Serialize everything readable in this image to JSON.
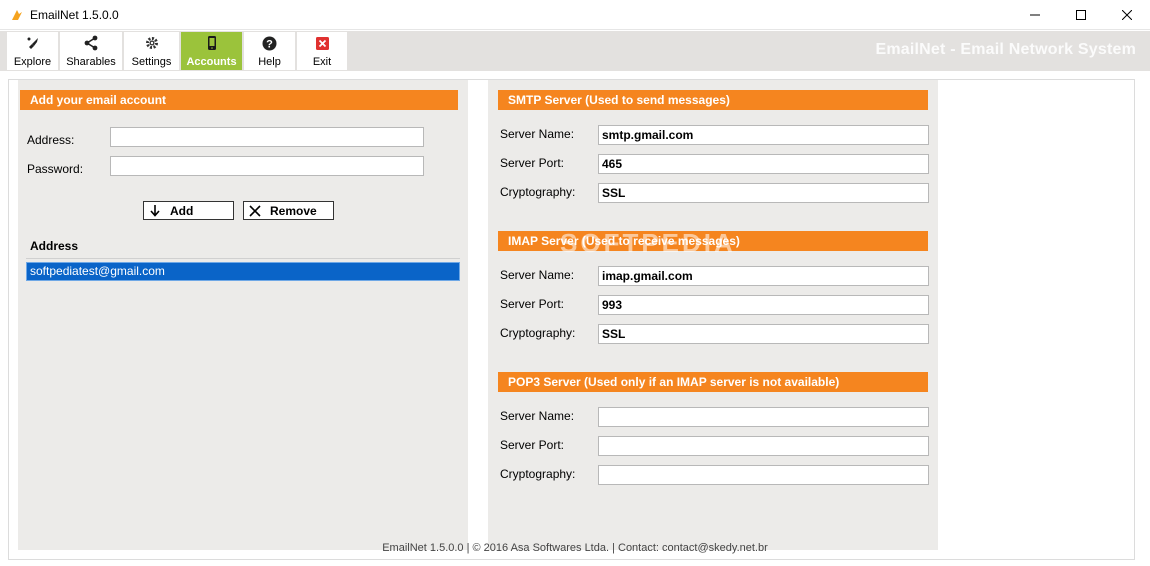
{
  "window": {
    "title": "EmailNet 1.5.0.0",
    "brand": "EmailNet - Email Network System"
  },
  "toolbar": {
    "items": [
      {
        "label": "Explore",
        "icon": "rocket-icon"
      },
      {
        "label": "Sharables",
        "icon": "share-icon"
      },
      {
        "label": "Settings",
        "icon": "gear-icon"
      },
      {
        "label": "Accounts",
        "icon": "phone-icon",
        "active": true
      },
      {
        "label": "Help",
        "icon": "help-icon"
      },
      {
        "label": "Exit",
        "icon": "close-icon"
      }
    ]
  },
  "account": {
    "header": "Add your email account",
    "address_label": "Address:",
    "address_value": "",
    "password_label": "Password:",
    "password_value": "",
    "add_label": "Add",
    "remove_label": "Remove",
    "list_header": "Address",
    "list_items": [
      "softpediatest@gmail.com"
    ]
  },
  "smtp": {
    "header": "SMTP Server (Used to send messages)",
    "server_name_label": "Server Name:",
    "server_name": "smtp.gmail.com",
    "server_port_label": "Server Port:",
    "server_port": "465",
    "crypto_label": "Cryptography:",
    "crypto": "SSL"
  },
  "imap": {
    "header": "IMAP Server (Used to receive messages)",
    "server_name_label": "Server Name:",
    "server_name": "imap.gmail.com",
    "server_port_label": "Server Port:",
    "server_port": "993",
    "crypto_label": "Cryptography:",
    "crypto": "SSL"
  },
  "pop3": {
    "header": "POP3 Server (Used only if an IMAP server is not available)",
    "server_name_label": "Server Name:",
    "server_name": "",
    "server_port_label": "Server Port:",
    "server_port": "",
    "crypto_label": "Cryptography:",
    "crypto": ""
  },
  "footer": "EmailNet 1.5.0.0  |  © 2016 Asa Softwares Ltda.  |  Contact: contact@skedy.net.br",
  "watermark": "SOFTPEDIA",
  "colors": {
    "accent_orange": "#f5851f",
    "active_green": "#9bc33b",
    "selection_blue": "#0a64c8",
    "panel_gray": "#ecebe9"
  }
}
